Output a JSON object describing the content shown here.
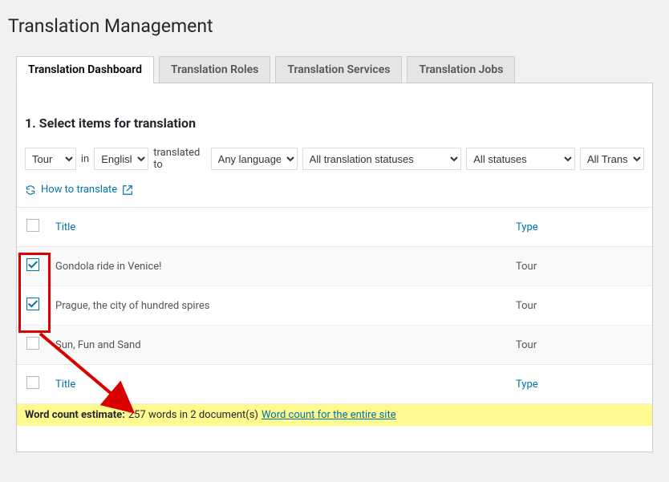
{
  "page_title": "Translation Management",
  "tabs": [
    {
      "label": "Translation Dashboard",
      "active": true
    },
    {
      "label": "Translation Roles",
      "active": false
    },
    {
      "label": "Translation Services",
      "active": false
    },
    {
      "label": "Translation Jobs",
      "active": false
    }
  ],
  "section_title": "1. Select items for translation",
  "filters": {
    "post_type": "Tour",
    "label_in": "in",
    "language": "English",
    "label_translated_to": "translated to",
    "target_language": "Any language",
    "translation_status": "All translation statuses",
    "publish_status": "All statuses",
    "translator": "All Transla"
  },
  "how_to_label": "How to translate",
  "table": {
    "header_title": "Title",
    "header_type": "Type",
    "rows": [
      {
        "title": "Gondola ride in Venice!",
        "type": "Tour",
        "checked": true
      },
      {
        "title": "Prague, the city of hundred spires",
        "type": "Tour",
        "checked": true
      },
      {
        "title": "Sun, Fun and Sand",
        "type": "Tour",
        "checked": false
      }
    ],
    "footer_title": "Title",
    "footer_type": "Type"
  },
  "estimate": {
    "label": "Word count estimate:",
    "text": "257 words in 2 document(s)",
    "link": "Word count for the entire site"
  }
}
